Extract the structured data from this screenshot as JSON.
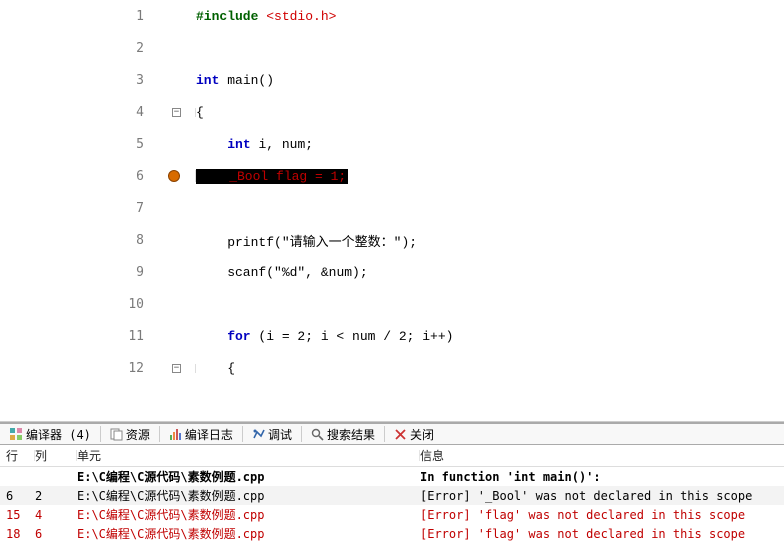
{
  "code": {
    "lines": [
      {
        "n": "1",
        "fold": "",
        "bp": false,
        "segments": [
          [
            "kw-pre",
            "#include "
          ],
          [
            "kw-incfile",
            "<stdio.h>"
          ]
        ]
      },
      {
        "n": "2",
        "fold": "",
        "bp": false,
        "segments": [
          [
            "kw-text",
            ""
          ]
        ]
      },
      {
        "n": "3",
        "fold": "",
        "bp": false,
        "segments": [
          [
            "kw-type",
            "int "
          ],
          [
            "kw-text",
            "main()"
          ]
        ]
      },
      {
        "n": "4",
        "fold": "−",
        "bp": false,
        "segments": [
          [
            "kw-text",
            "{"
          ]
        ]
      },
      {
        "n": "5",
        "fold": "",
        "bp": false,
        "segments": [
          [
            "kw-text",
            "    "
          ],
          [
            "kw-type",
            "int "
          ],
          [
            "kw-text",
            "i, num;"
          ]
        ]
      },
      {
        "n": "6",
        "fold": "",
        "bp": true,
        "highlight": true,
        "segments": [
          [
            "kw-text",
            "    _Bool flag = 1;"
          ]
        ]
      },
      {
        "n": "7",
        "fold": "",
        "bp": false,
        "segments": [
          [
            "kw-text",
            ""
          ]
        ]
      },
      {
        "n": "8",
        "fold": "",
        "bp": false,
        "segments": [
          [
            "kw-text",
            "    printf("
          ],
          [
            "kw-str",
            "\"请输入一个整数：\""
          ],
          [
            "kw-text",
            ");"
          ]
        ]
      },
      {
        "n": "9",
        "fold": "",
        "bp": false,
        "segments": [
          [
            "kw-text",
            "    scanf("
          ],
          [
            "kw-str",
            "\"%d\""
          ],
          [
            "kw-text",
            ", &num);"
          ]
        ]
      },
      {
        "n": "10",
        "fold": "",
        "bp": false,
        "segments": [
          [
            "kw-text",
            ""
          ]
        ]
      },
      {
        "n": "11",
        "fold": "",
        "bp": false,
        "segments": [
          [
            "kw-type",
            "    for "
          ],
          [
            "kw-text",
            "(i = 2; i < num / 2; i++)"
          ]
        ]
      },
      {
        "n": "12",
        "fold": "−",
        "bp": false,
        "segments": [
          [
            "kw-text",
            "    {"
          ]
        ]
      }
    ]
  },
  "panel": {
    "tabs": {
      "compiler": "编译器 (4)",
      "resources": "资源",
      "log": "编译日志",
      "debug": "调试",
      "search": "搜索结果",
      "close": "关闭"
    },
    "headers": {
      "line": "行",
      "col": "列",
      "unit": "单元",
      "info": "信息"
    },
    "rows": [
      {
        "line": "",
        "col": "",
        "unit": "E:\\C编程\\C源代码\\素数例题.cpp",
        "info": "In function 'int main()':",
        "bold": true
      },
      {
        "line": "6",
        "col": "2",
        "unit": "E:\\C编程\\C源代码\\素数例题.cpp",
        "info": "[Error] '_Bool' was not declared in this scope",
        "alt": true
      },
      {
        "line": "15",
        "col": "4",
        "unit": "E:\\C编程\\C源代码\\素数例题.cpp",
        "info": "[Error] 'flag' was not declared in this scope",
        "err": true
      },
      {
        "line": "18",
        "col": "6",
        "unit": "E:\\C编程\\C源代码\\素数例题.cpp",
        "info": "[Error] 'flag' was not declared in this scope",
        "err": true
      }
    ]
  }
}
